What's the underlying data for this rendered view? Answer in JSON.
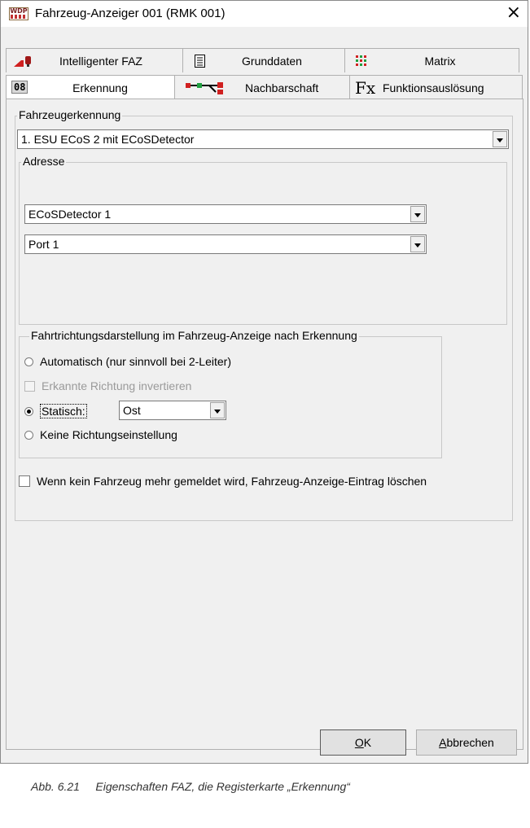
{
  "window": {
    "title": "Fahrzeug-Anzeiger 001 (RMK 001)",
    "close_glyph": "×",
    "app_icon_text": "WDP"
  },
  "tabs": {
    "row1": [
      {
        "label": "Intelligenter FAZ",
        "icon": "train-signal-icon"
      },
      {
        "label": "Grunddaten",
        "icon": "document-icon"
      },
      {
        "label": "Matrix",
        "icon": "matrix-grid-icon"
      }
    ],
    "row2": [
      {
        "label": "Erkennung",
        "icon": "number-08-icon",
        "icon_text": "08",
        "active": true
      },
      {
        "label": "Nachbarschaft",
        "icon": "neighborhood-connector-icon"
      },
      {
        "label": "Funktionsauslösung",
        "icon": "fx-function-icon",
        "icon_text": "Fx"
      }
    ]
  },
  "recognition": {
    "legend": "Fahrzeugerkennung",
    "selected": "1. ESU ECoS 2 mit ECoSDetector"
  },
  "address": {
    "legend": "Adresse",
    "detector": "ECoSDetector 1",
    "port": "Port 1"
  },
  "direction": {
    "legend": "Fahrtrichtungsdarstellung  im Fahrzeug-Anzeige nach Erkennung",
    "opt_auto": "Automatisch (nur sinnvoll bei 2-Leiter)",
    "opt_invert": "Erkannte Richtung invertieren",
    "opt_static": "Statisch:",
    "static_value": "Ost",
    "opt_none": "Keine Richtungseinstellung",
    "selected": "static"
  },
  "delete_entry": {
    "label": "Wenn kein Fahrzeug mehr gemeldet wird, Fahrzeug-Anzeige-Eintrag löschen",
    "checked": false
  },
  "buttons": {
    "ok_mnemonic": "O",
    "ok_rest": "K",
    "cancel_mnemonic": "A",
    "cancel_rest": "bbrechen"
  },
  "caption": "Abb. 6.21     Eigenschaften FAZ, die Registerkarte „Erkennung“",
  "colors": {
    "window_bg": "#f0f0f0",
    "tab_active_bg": "#ffffff",
    "icon_red": "#d02020",
    "icon_green": "#20a040"
  }
}
